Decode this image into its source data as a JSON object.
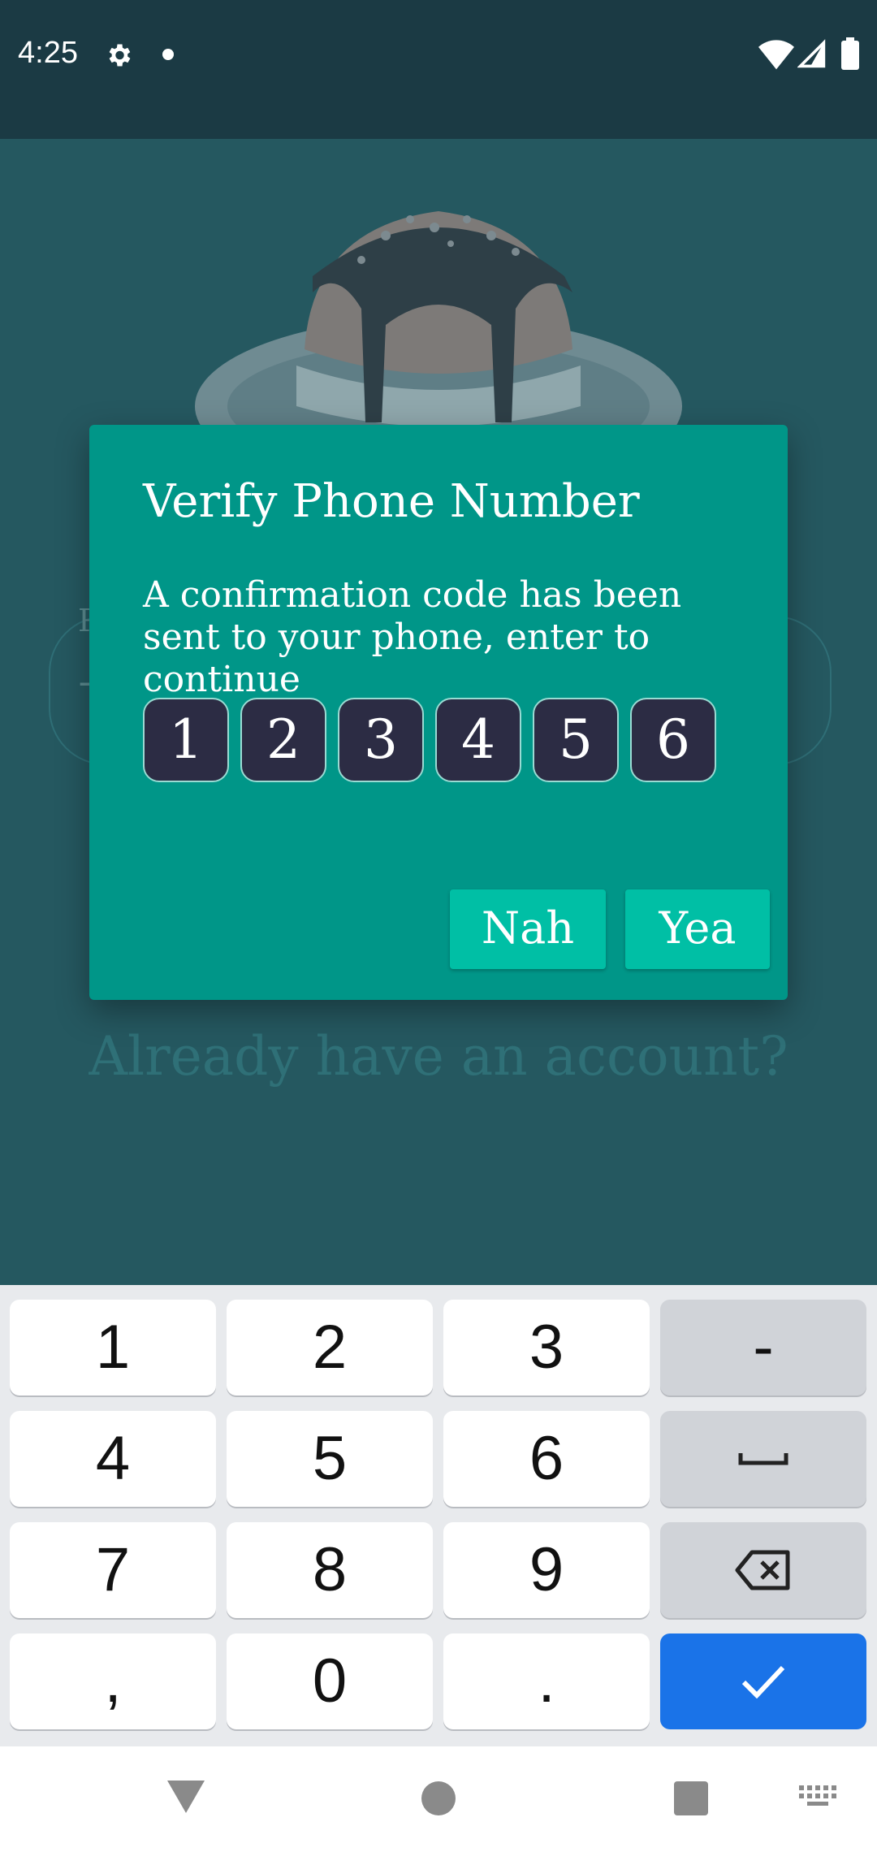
{
  "status_bar": {
    "time": "4:25",
    "icons": [
      "gear-icon",
      "dot-icon",
      "wifi-icon",
      "signal-icon",
      "battery-icon"
    ]
  },
  "background": {
    "phone_field_label": "P",
    "phone_field_prefix": "+",
    "login_link": "Already have an account?"
  },
  "dialog": {
    "title": "Verify Phone Number",
    "message": "A confirmation code has been sent to your phone, enter to continue",
    "code": [
      "1",
      "2",
      "3",
      "4",
      "5",
      "6"
    ],
    "cancel_label": "Nah",
    "confirm_label": "Yea"
  },
  "keyboard": {
    "rows": [
      [
        "1",
        "2",
        "3",
        "-"
      ],
      [
        "4",
        "5",
        "6",
        "space-icon"
      ],
      [
        "7",
        "8",
        "9",
        "backspace-icon"
      ],
      [
        ",",
        "0",
        ".",
        "checkmark-icon"
      ]
    ]
  },
  "colors": {
    "accent": "#009688",
    "button": "#00bfa5",
    "enter_key": "#1a73e8",
    "status_bar": "#1b3a44"
  }
}
